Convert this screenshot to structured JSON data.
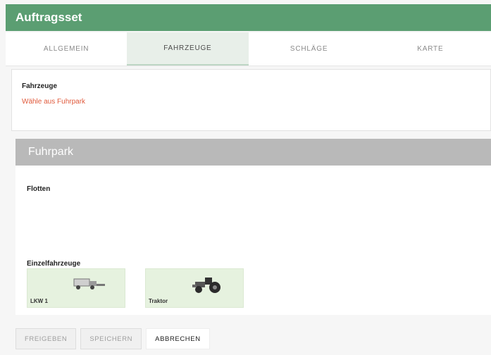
{
  "title": "Auftragsset",
  "tabs": [
    {
      "label": "ALLGEMEIN",
      "active": false
    },
    {
      "label": "FAHRZEUGE",
      "active": true
    },
    {
      "label": "SCHLÄGE",
      "active": false
    },
    {
      "label": "KARTE",
      "active": false
    }
  ],
  "vehicles_card": {
    "label": "Fahrzeuge",
    "link": "Wähle aus Fuhrpark"
  },
  "fuhrpark": {
    "header": "Fuhrpark",
    "fleets_label": "Flotten",
    "single_label": "Einzelfahrzeuge",
    "vehicles": [
      {
        "name": "LKW 1",
        "icon": "truck-icon"
      },
      {
        "name": "Traktor",
        "icon": "tractor-icon"
      }
    ]
  },
  "buttons": {
    "release": "FREIGEBEN",
    "save": "SPEICHERN",
    "cancel": "ABBRECHEN"
  },
  "colors": {
    "header": "#5b9e72",
    "link": "#e05a3c",
    "section": "#b9b9b9",
    "vehicle_card": "#e6f2df"
  }
}
